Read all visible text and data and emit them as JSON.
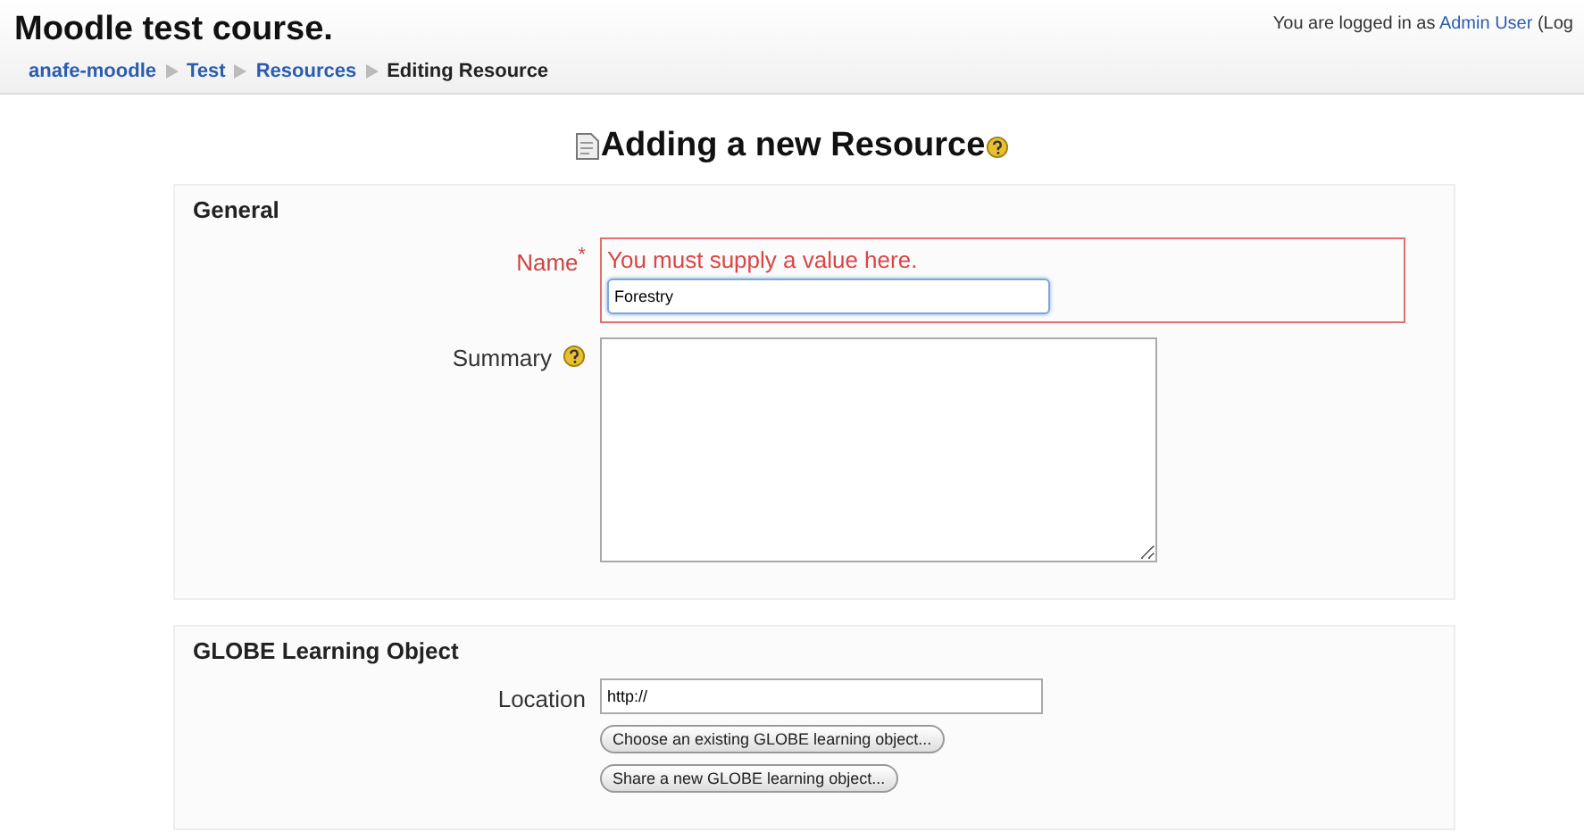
{
  "header": {
    "site_title": "Moodle test course.",
    "login_text": "You are logged in as ",
    "login_user": "Admin User",
    "login_tail": " (Log"
  },
  "breadcrumb": [
    {
      "label": "anafe-moodle",
      "link": true
    },
    {
      "label": "Test",
      "link": true
    },
    {
      "label": "Resources",
      "link": true
    },
    {
      "label": "Editing Resource",
      "link": false
    }
  ],
  "page_title": "Adding a new Resource",
  "sections": [
    {
      "legend": "General",
      "fields": [
        {
          "kind": "text",
          "label": "Name",
          "required_mark": "*",
          "error": "You must supply a value here.",
          "value": "Forestry",
          "focused": true
        },
        {
          "kind": "textarea",
          "label": "Summary",
          "help": true
        }
      ]
    },
    {
      "legend": "GLOBE Learning Object",
      "fields": [
        {
          "kind": "text",
          "label": "Location",
          "value": "http://",
          "focused": false,
          "buttons": [
            "Choose an existing GLOBE learning object...",
            "Share a new GLOBE learning object..."
          ]
        }
      ]
    }
  ]
}
